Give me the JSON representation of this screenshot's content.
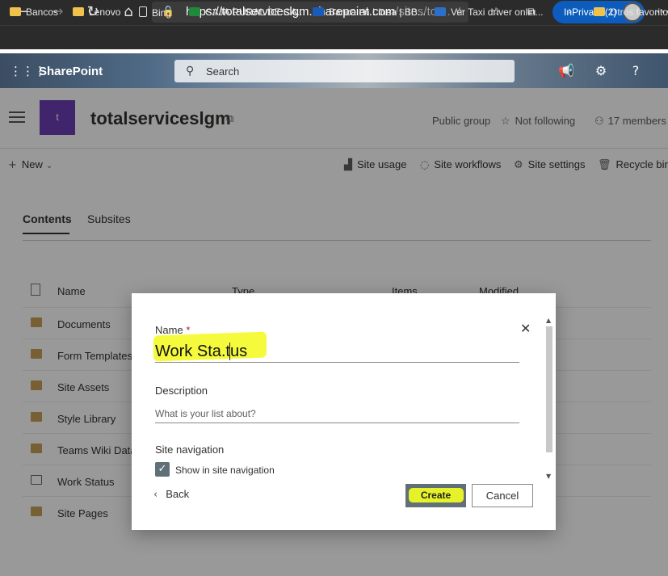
{
  "browser": {
    "url_main": "https://totalserviceslgm.sharepoint.com",
    "url_path": "/sites/tot...",
    "inprivate_label": "InPrivate (2)",
    "bookmarks": [
      "Bancos",
      "Lenovo",
      "Bing",
      "CAJA RURAL DE CA...",
      "Banca en Línea | BB...",
      "Ver Taxi driver onlin...",
      "Otros favorito"
    ]
  },
  "suite": {
    "app_name": "SharePoint",
    "search_placeholder": "Search"
  },
  "site": {
    "logo_letter": "t",
    "name": "totalserviceslgm",
    "privacy": "Public group",
    "follow": "Not following",
    "members": "17 members"
  },
  "commands": {
    "new": "New",
    "site_usage": "Site usage",
    "site_workflows": "Site workflows",
    "site_settings": "Site settings",
    "recycle_bin": "Recycle bin"
  },
  "tabs": [
    "Contents",
    "Subsites"
  ],
  "table": {
    "columns": [
      "Name",
      "Type",
      "Items",
      "Modified"
    ],
    "rows": [
      "Documents",
      "Form Templates",
      "Site Assets",
      "Style Library",
      "Teams Wiki Data",
      "Work Status",
      "Site Pages"
    ]
  },
  "dialog": {
    "name_label": "Name",
    "required_mark": "*",
    "name_value": "Work Sta.tus",
    "description_label": "Description",
    "description_placeholder": "What is your list about?",
    "site_nav_label": "Site navigation",
    "show_in_nav_label": "Show in site navigation",
    "show_in_nav_checked": true,
    "back_label": "Back",
    "create_label": "Create",
    "cancel_label": "Cancel"
  },
  "colors": {
    "browser_chrome": "#2b2b2b",
    "inprivate": "#0b5cbd",
    "site_logo": "#6b3fb5",
    "highlight": "#f5fb3c",
    "checkbox": "#616f76"
  }
}
